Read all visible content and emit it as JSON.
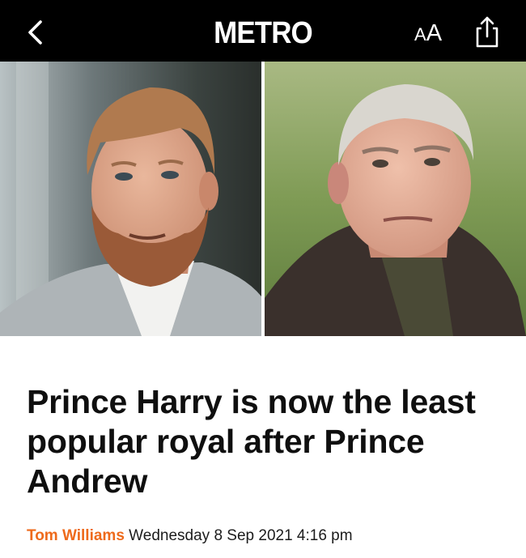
{
  "header": {
    "logo": "METRO",
    "back_icon": "chevron-left-icon",
    "text_size": {
      "small": "A",
      "large": "A"
    },
    "share_icon": "share-icon"
  },
  "article": {
    "headline": "Prince Harry is now the least popular royal after Prince Andrew",
    "author": "Tom Williams",
    "date": "Wednesday 8 Sep 2021 4:16 pm"
  },
  "colors": {
    "header_bg": "#000000",
    "author": "#ee6a1b",
    "headline": "#0f0f0f"
  }
}
